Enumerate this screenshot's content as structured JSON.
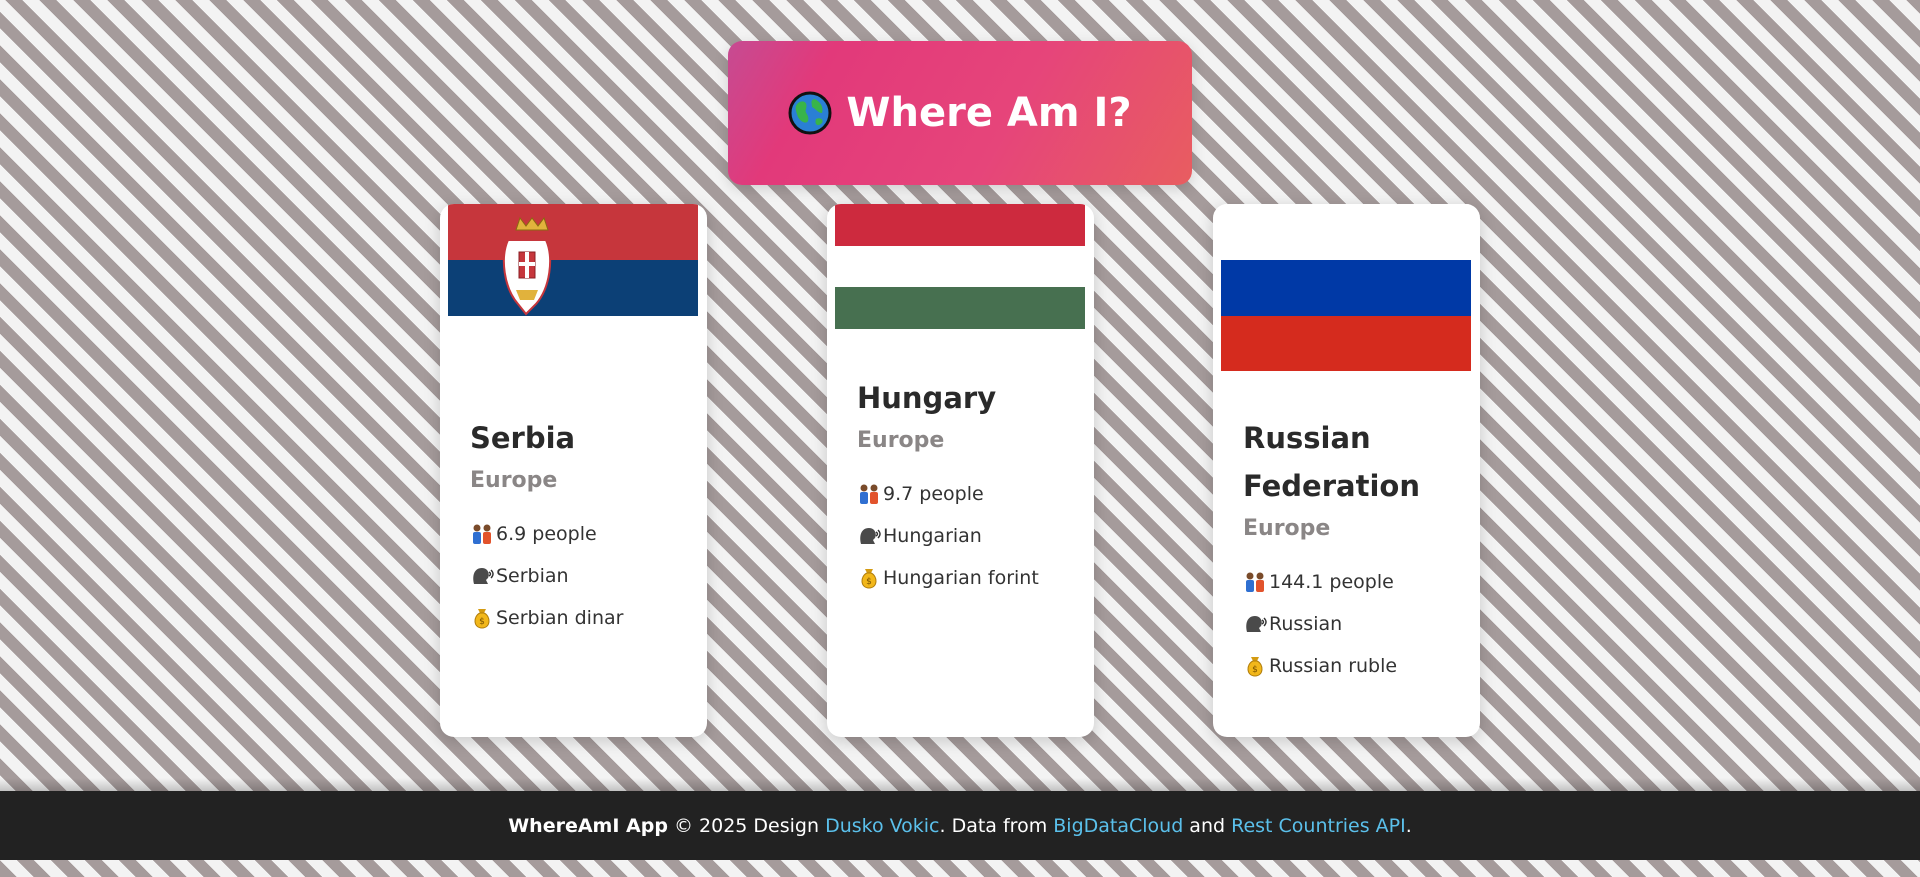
{
  "header": {
    "icon": "globe-icon",
    "title": "Where Am I?"
  },
  "cards": [
    {
      "name": "Serbia",
      "region": "Europe",
      "population": "6.9 people",
      "language": "Serbian",
      "currency": "Serbian dinar",
      "flag": {
        "stripes": [
          "#c6363c",
          "#0c4076",
          "#ffffff"
        ]
      }
    },
    {
      "name": "Hungary",
      "region": "Europe",
      "population": "9.7 people",
      "language": "Hungarian",
      "currency": "Hungarian forint",
      "flag": {
        "stripes": [
          "#cd2a3e",
          "#ffffff",
          "#477050"
        ]
      }
    },
    {
      "name": "Russian Federation",
      "region": "Europe",
      "population": "144.1 people",
      "language": "Russian",
      "currency": "Russian ruble",
      "flag": {
        "stripes": [
          "#ffffff",
          "#0039a6",
          "#d52b1e"
        ]
      }
    }
  ],
  "footer": {
    "app_name": "WhereAmI App",
    "copyright": " © 2025 Design ",
    "designer": "Dusko Vokic",
    "data_from": ". Data from ",
    "source1": "BigDataCloud",
    "and": " and ",
    "source2": "Rest Countries API",
    "end": "."
  },
  "icons": {
    "population": "people-icon",
    "language": "speaking-head-icon",
    "currency": "money-bag-icon"
  }
}
